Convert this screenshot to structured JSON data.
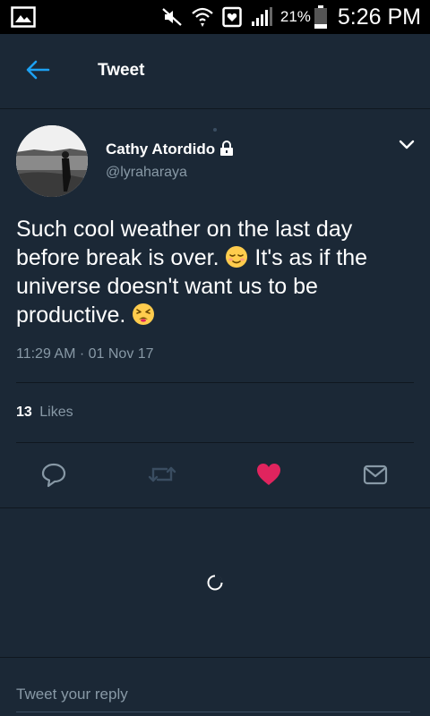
{
  "status_bar": {
    "battery_percent": "21%",
    "time": "5:26 PM"
  },
  "header": {
    "title": "Tweet"
  },
  "tweet": {
    "display_name": "Cathy Atordido",
    "handle": "@lyraharaya",
    "text_part1": "Such cool weather on the last day before break is over.",
    "text_part2": "It's as if the universe doesn't want us to be productive.",
    "timestamp": "11:29 AM · 01 Nov 17",
    "likes_count": "13",
    "likes_label": "Likes",
    "liked": true
  },
  "reply": {
    "placeholder": "Tweet your reply"
  },
  "colors": {
    "background": "#1b2836",
    "accent": "#1da1f2",
    "like": "#e0245e",
    "secondary_text": "#8899a6"
  },
  "icons": [
    "gallery-icon",
    "mute-icon",
    "wifi-icon",
    "notification-icon",
    "signal-icon",
    "battery-icon",
    "back-arrow-icon",
    "lock-icon",
    "chevron-down-icon",
    "reply-icon",
    "retweet-icon",
    "heart-icon",
    "message-icon",
    "loading-spinner-icon",
    "relieved-face-emoji",
    "persevering-face-emoji"
  ]
}
